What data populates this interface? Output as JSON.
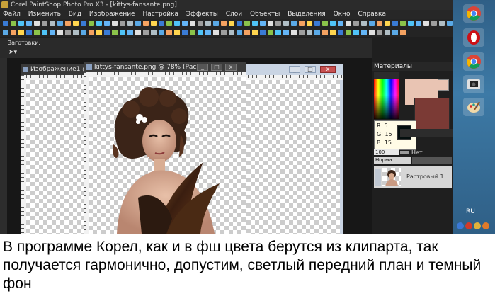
{
  "app": {
    "title": "Corel PaintShop Photo Pro X3 - [kittys-fansante.png]"
  },
  "menu": {
    "items": [
      "Файл",
      "Изменить",
      "Вид",
      "Изображение",
      "Настройка",
      "Эффекты",
      "Слои",
      "Объекты",
      "Выделения",
      "Окно",
      "Справка"
    ]
  },
  "options": {
    "presets_label": "Заготовки:"
  },
  "windows": {
    "doc1_title": "Изображение1 @",
    "doc2_title": "kittys-fansante.png  @ 78% (Рас..."
  },
  "materials": {
    "title": "Материалы",
    "foreground_color": "#e9c4b3",
    "background_color": "#7b3a35",
    "picked_color": "#050f0f",
    "tooltip": {
      "r": "R: 5",
      "g": "G: 15",
      "b": "B: 15"
    }
  },
  "layers": {
    "opacity": "100",
    "none_label": "Нет",
    "blend_mode": "Норма",
    "layer_name": "Растровый 1"
  },
  "sidebar": {
    "icons": [
      "chrome-icon",
      "opera-icon",
      "chrome-icon",
      "media-icon",
      "paint-icon"
    ],
    "language": "RU"
  },
  "caption": {
    "text": "В программе Корел, как и в фш цвета берутся из клипарта, так получается гармонично, допустим, светлый передний план и темный фон"
  }
}
